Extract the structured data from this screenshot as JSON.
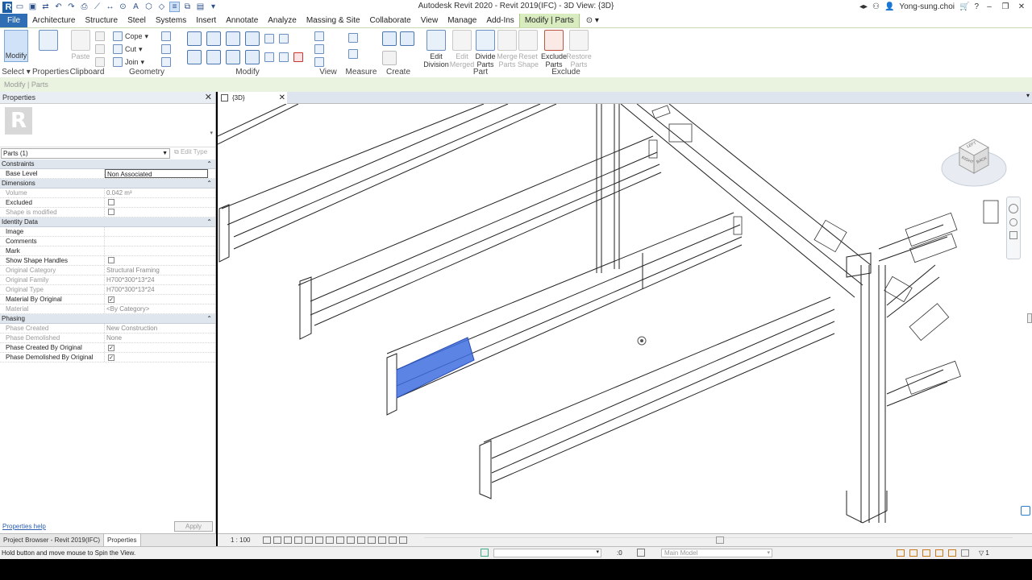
{
  "window": {
    "title": "Autodesk Revit 2020 - Revit 2019(IFC) - 3D View: {3D}",
    "user": "Yong-sung.choi"
  },
  "ribbon_tabs": [
    "File",
    "Architecture",
    "Structure",
    "Steel",
    "Systems",
    "Insert",
    "Annotate",
    "Analyze",
    "Massing & Site",
    "Collaborate",
    "View",
    "Manage",
    "Add-Ins",
    "Modify | Parts"
  ],
  "ribbon": {
    "select_label": "Select",
    "modify_label": "Modify",
    "properties_label": "Properties",
    "clipboard_label": "Clipboard",
    "paste_label": "Paste",
    "cope_label": "Cope",
    "cut_label": "Cut",
    "join_label": "Join",
    "geometry_label": "Geometry",
    "modify_panel_label": "Modify",
    "view_label": "View",
    "measure_label": "Measure",
    "create_label": "Create",
    "part_label": "Part",
    "exclude_label": "Exclude",
    "buttons": {
      "edit_division": [
        "Edit",
        "Division"
      ],
      "edit_merged": [
        "Edit",
        "Merged"
      ],
      "divide_parts": [
        "Divide",
        "Parts"
      ],
      "merge_parts": [
        "Merge",
        "Parts"
      ],
      "reset_shape": [
        "Reset",
        "Shape"
      ],
      "exclude_parts": [
        "Exclude",
        "Parts"
      ],
      "restore_parts": [
        "Restore",
        "Parts"
      ]
    }
  },
  "optbar": {
    "text": "Modify | Parts"
  },
  "properties": {
    "header": "Properties",
    "filter": "Parts (1)",
    "edit_type": "Edit Type",
    "groups": {
      "constraints": "Constraints",
      "dimensions": "Dimensions",
      "identity": "Identity Data",
      "phasing": "Phasing"
    },
    "rows": {
      "base_level": {
        "k": "Base Level",
        "v": "Non Associated"
      },
      "volume": {
        "k": "Volume",
        "v": "0.042 m³"
      },
      "excluded": {
        "k": "Excluded",
        "v": ""
      },
      "shape_modified": {
        "k": "Shape is modified",
        "v": ""
      },
      "image": {
        "k": "Image",
        "v": ""
      },
      "comments": {
        "k": "Comments",
        "v": ""
      },
      "mark": {
        "k": "Mark",
        "v": ""
      },
      "show_handles": {
        "k": "Show Shape Handles",
        "v": ""
      },
      "orig_category": {
        "k": "Original Category",
        "v": "Structural Framing"
      },
      "orig_family": {
        "k": "Original Family",
        "v": "H700*300*13*24"
      },
      "orig_type": {
        "k": "Original Type",
        "v": "H700*300*13*24"
      },
      "mat_by_orig": {
        "k": "Material By Original",
        "v": "✓"
      },
      "material": {
        "k": "Material",
        "v": "<By Category>"
      },
      "phase_created": {
        "k": "Phase Created",
        "v": "New Construction"
      },
      "phase_demolished": {
        "k": "Phase Demolished",
        "v": "None"
      },
      "phase_created_orig": {
        "k": "Phase Created By Original",
        "v": "✓"
      },
      "phase_demolished_orig": {
        "k": "Phase Demolished By Original",
        "v": "✓"
      }
    },
    "help": "Properties help",
    "apply": "Apply"
  },
  "bottom_tabs": [
    "Project Browser - Revit 2019(IFC)",
    "Properties"
  ],
  "view": {
    "tab": "{3D}",
    "scale": "1 : 100"
  },
  "viewcube": {
    "top": "LEFT",
    "front": "BACK",
    "left": "RIGHT"
  },
  "status": {
    "message": "Hold button and move mouse to Spin the View.",
    "zero": ":0",
    "model": "Main Model",
    "filter_count": "1"
  },
  "colors": {
    "accent": "#2f6db5",
    "context_tab": "#d9ecc0",
    "selection": "#3f6fe0"
  }
}
